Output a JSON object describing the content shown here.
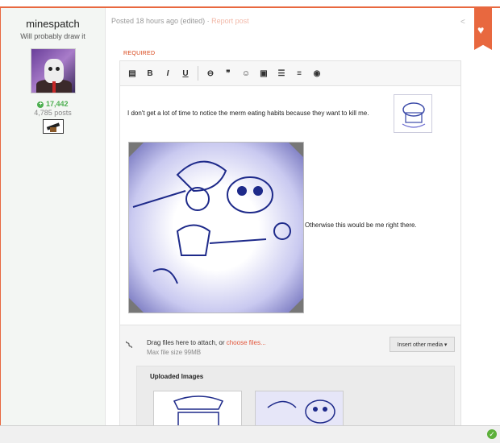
{
  "author": {
    "name": "minespatch",
    "title": "Will probably draw it",
    "reputation": "17,442",
    "posts": "4,785 posts"
  },
  "post": {
    "meta": "Posted 18 hours ago (edited)",
    "report": "Report post",
    "separator": " · "
  },
  "editor": {
    "required_label": "REQUIRED",
    "toolbar": [
      {
        "name": "source-icon",
        "glyph": "▤"
      },
      {
        "name": "bold-button",
        "glyph": "B"
      },
      {
        "name": "italic-button",
        "glyph": "I"
      },
      {
        "name": "underline-button",
        "glyph": "U"
      },
      {
        "name": "link-icon",
        "glyph": "⊖"
      },
      {
        "name": "quote-icon",
        "glyph": "❞"
      },
      {
        "name": "emoji-icon",
        "glyph": "☺"
      },
      {
        "name": "image-icon",
        "glyph": "▣"
      },
      {
        "name": "bullet-list-icon",
        "glyph": "☰"
      },
      {
        "name": "numbered-list-icon",
        "glyph": "≡"
      },
      {
        "name": "preview-icon",
        "glyph": "◉"
      }
    ],
    "line1": "I don't get a lot of time to notice the merm eating habits because they want to kill me.",
    "line2": "Otherwise this would be me right there."
  },
  "attachments": {
    "drag_text": "Drag files here to attach, or ",
    "choose_link": "choose files...",
    "max_size": "Max file size 99MB",
    "insert_button": "Insert other media ▾",
    "uploaded_title": "Uploaded Images"
  },
  "colors": {
    "accent": "#e8683f",
    "reputation": "#4caf50",
    "link": "#e2563b"
  }
}
